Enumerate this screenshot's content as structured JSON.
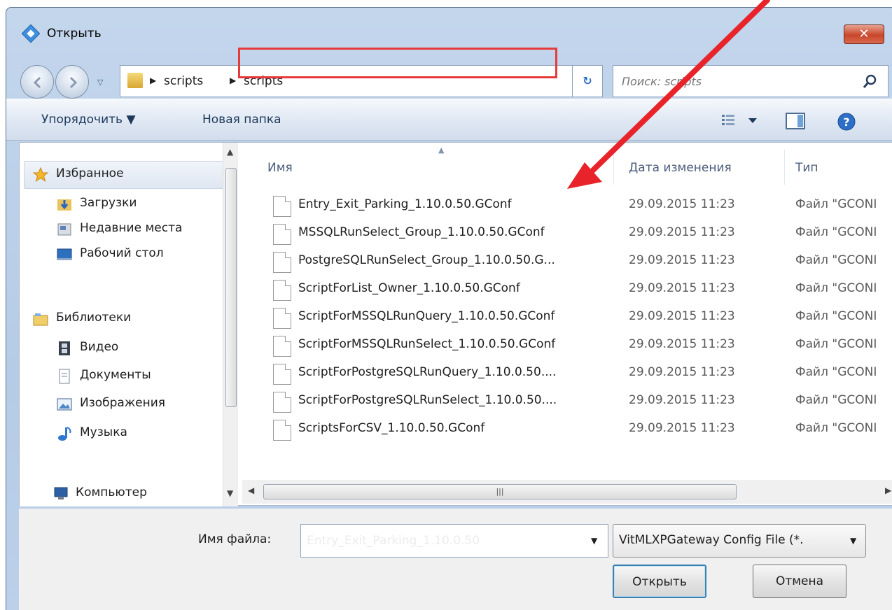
{
  "window": {
    "title": "Открыть",
    "close_label": "✕"
  },
  "nav": {
    "breadcrumbs": [
      "scripts",
      "scripts"
    ],
    "search_placeholder": "Поиск: scripts"
  },
  "toolbar": {
    "organize_label": "Упорядочить ▼",
    "new_folder_label": "Новая папка"
  },
  "sidebar": {
    "items": [
      {
        "label": "Избранное",
        "icon": "star-icon"
      },
      {
        "label": "Загрузки",
        "icon": "downloads-folder-icon"
      },
      {
        "label": "Недавние места",
        "icon": "recent-places-icon"
      },
      {
        "label": "Рабочий стол",
        "icon": "desktop-icon"
      },
      {
        "label": "Библиотеки",
        "icon": "libraries-icon"
      },
      {
        "label": "Видео",
        "icon": "video-icon"
      },
      {
        "label": "Документы",
        "icon": "documents-icon"
      },
      {
        "label": "Изображения",
        "icon": "images-icon"
      },
      {
        "label": "Музыка",
        "icon": "music-icon"
      },
      {
        "label": "Компьютер",
        "icon": "computer-icon"
      }
    ]
  },
  "columns": {
    "name": "Имя",
    "date": "Дата изменения",
    "type": "Тип"
  },
  "files": [
    {
      "name": "Entry_Exit_Parking_1.10.0.50.GConf",
      "date": "29.09.2015 11:23",
      "type": "Файл \"GCONI"
    },
    {
      "name": "MSSQLRunSelect_Group_1.10.0.50.GConf",
      "date": "29.09.2015 11:23",
      "type": "Файл \"GCONI"
    },
    {
      "name": "PostgreSQLRunSelect_Group_1.10.0.50.G...",
      "date": "29.09.2015 11:23",
      "type": "Файл \"GCONI"
    },
    {
      "name": "ScriptForList_Owner_1.10.0.50.GConf",
      "date": "29.09.2015 11:23",
      "type": "Файл \"GCONI"
    },
    {
      "name": "ScriptForMSSQLRunQuery_1.10.0.50.GConf",
      "date": "29.09.2015 11:23",
      "type": "Файл \"GCONI"
    },
    {
      "name": "ScriptForMSSQLRunSelect_1.10.0.50.GConf",
      "date": "29.09.2015 11:23",
      "type": "Файл \"GCONI"
    },
    {
      "name": "ScriptForPostgreSQLRunQuery_1.10.0.50....",
      "date": "29.09.2015 11:23",
      "type": "Файл \"GCONI"
    },
    {
      "name": "ScriptForPostgreSQLRunSelect_1.10.0.50....",
      "date": "29.09.2015 11:23",
      "type": "Файл \"GCONI"
    },
    {
      "name": "ScriptsForCSV_1.10.0.50.GConf",
      "date": "29.09.2015 11:23",
      "type": "Файл \"GCONI"
    }
  ],
  "bottom": {
    "filename_label": "Имя файла:",
    "filename_value": "Entry_Exit_Parking_1.10.0.50",
    "filetype_value": "VitMLXPGateway Config File (*.",
    "open_label": "Открыть",
    "cancel_label": "Отмена"
  },
  "colors": {
    "annotation": "#e53b3b",
    "selection_box": "#e53b3b"
  }
}
